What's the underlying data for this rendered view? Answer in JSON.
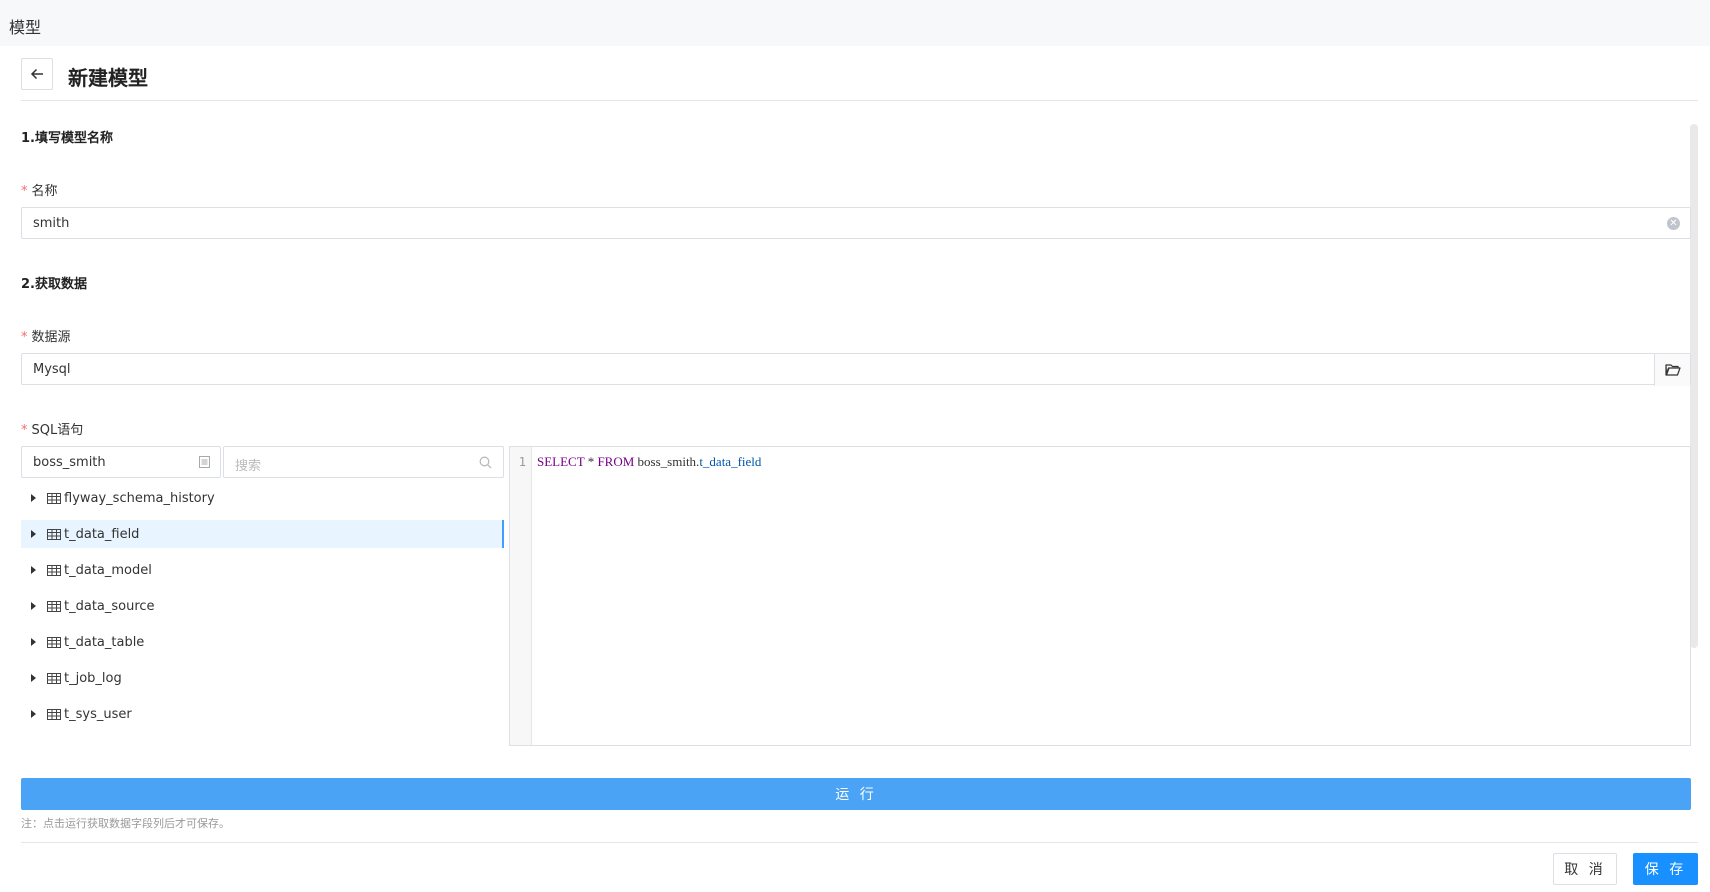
{
  "topbar": {
    "title": "模型"
  },
  "header": {
    "title": "新建模型"
  },
  "section1": {
    "title": "1.填写模型名称"
  },
  "name_field": {
    "label": "名称",
    "value": "smith"
  },
  "section2": {
    "title": "2.获取数据"
  },
  "datasource_field": {
    "label": "数据源",
    "value": "Mysql"
  },
  "sql_field": {
    "label": "SQL语句"
  },
  "schema_select": {
    "value": "boss_smith"
  },
  "table_search": {
    "placeholder": "搜索"
  },
  "tables": [
    {
      "name": "flyway_schema_history",
      "selected": false
    },
    {
      "name": "t_data_field",
      "selected": true
    },
    {
      "name": "t_data_model",
      "selected": false
    },
    {
      "name": "t_data_source",
      "selected": false
    },
    {
      "name": "t_data_table",
      "selected": false
    },
    {
      "name": "t_job_log",
      "selected": false
    },
    {
      "name": "t_sys_user",
      "selected": false
    }
  ],
  "editor": {
    "line_number": "1",
    "tokens": {
      "select": "SELECT",
      "star": "*",
      "from": "FROM",
      "schema": "boss_smith.",
      "table": "t_data_field"
    }
  },
  "actions": {
    "run_label": "运 行",
    "note": "注：点击运行获取数据字段列后才可保存。",
    "cancel_label": "取 消",
    "save_label": "保 存"
  },
  "colors": {
    "primary": "#1890ff",
    "run_button": "#4ba3f5",
    "required": "#f56c6c",
    "selected_row": "#e8f4ff"
  }
}
